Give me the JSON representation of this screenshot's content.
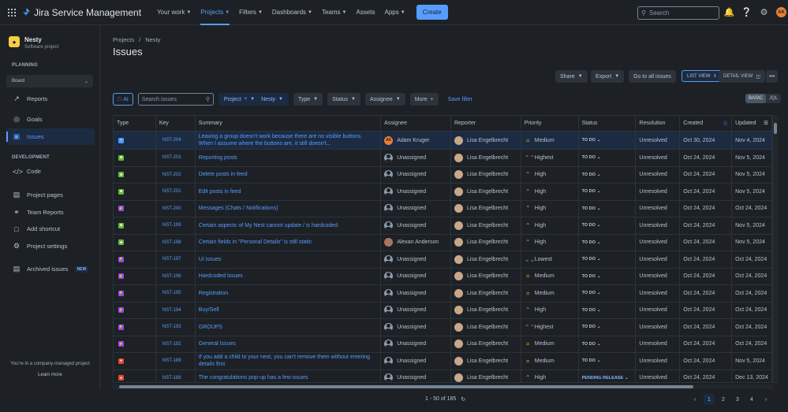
{
  "app": {
    "title": "Jira Service Management"
  },
  "nav": {
    "items": [
      {
        "label": "Your work",
        "active": false
      },
      {
        "label": "Projects",
        "active": true
      },
      {
        "label": "Filters",
        "active": false
      },
      {
        "label": "Dashboards",
        "active": false
      },
      {
        "label": "Teams",
        "active": false
      },
      {
        "label": "Assets",
        "active": false
      },
      {
        "label": "Apps",
        "active": false
      }
    ],
    "create_label": "Create",
    "search_placeholder": "Search",
    "user_initials": "AK"
  },
  "sidebar": {
    "project_name": "Nesty",
    "project_type": "Software project",
    "planning_heading": "PLANNING",
    "board_label": "Board",
    "reports_label": "Reports",
    "goals_label": "Goals",
    "issues_label": "Issues",
    "development_heading": "DEVELOPMENT",
    "code_label": "Code",
    "project_pages_label": "Project pages",
    "team_reports_label": "Team Reports",
    "add_shortcut_label": "Add shortcut",
    "project_settings_label": "Project settings",
    "archived_label": "Archived issues",
    "new_badge": "NEW",
    "footer_text": "You're in a company-managed project",
    "learn_more": "Learn more"
  },
  "page": {
    "breadcrumb": [
      "Projects",
      "Nesty"
    ],
    "title": "Issues",
    "share": "Share",
    "export": "Export",
    "go_all": "Go to all issues",
    "list_view": "LIST VIEW",
    "detail_view": "DETAIL VIEW"
  },
  "filters": {
    "ai": "AI",
    "search_placeholder": "Search issues",
    "project": "Project",
    "project_value": "Nesty",
    "type": "Type",
    "status": "Status",
    "assignee": "Assignee",
    "more": "More",
    "save": "Save filter",
    "basic": "BASIC",
    "jql": "JQL"
  },
  "table": {
    "columns": [
      "Type",
      "Key",
      "Summary",
      "Assignee",
      "Reporter",
      "Priority",
      "Status",
      "Resolution",
      "Created",
      "Updated"
    ],
    "rows": [
      {
        "type": "task",
        "key": "NST-204",
        "summary": "Leaving a group doesn't work because there are no visible buttons. When I assume where the buttons are, it still doesn't...",
        "assignee": "Adam Kruger",
        "assignee_av": "ak",
        "reporter": "Lisa Engelbrecht",
        "priority": "Medium",
        "status": "TO DO",
        "resolution": "Unresolved",
        "created": "Oct 30, 2024",
        "updated": "Nov 4, 2024"
      },
      {
        "type": "story",
        "key": "NST-203",
        "summary": "Reporting posts",
        "assignee": "Unassigned",
        "assignee_av": "un",
        "reporter": "Lisa Engelbrecht",
        "priority": "Highest",
        "status": "TO DO",
        "resolution": "Unresolved",
        "created": "Oct 24, 2024",
        "updated": "Nov 5, 2024"
      },
      {
        "type": "story",
        "key": "NST-202",
        "summary": "Delete posts in feed",
        "assignee": "Unassigned",
        "assignee_av": "un",
        "reporter": "Lisa Engelbrecht",
        "priority": "High",
        "status": "TO DO",
        "resolution": "Unresolved",
        "created": "Oct 24, 2024",
        "updated": "Nov 5, 2024"
      },
      {
        "type": "story",
        "key": "NST-201",
        "summary": "Edit posts in feed",
        "assignee": "Unassigned",
        "assignee_av": "un",
        "reporter": "Lisa Engelbrecht",
        "priority": "High",
        "status": "TO DO",
        "resolution": "Unresolved",
        "created": "Oct 24, 2024",
        "updated": "Nov 5, 2024"
      },
      {
        "type": "epic",
        "key": "NST-200",
        "summary": "Messages (Chats / Notifications)",
        "assignee": "Unassigned",
        "assignee_av": "un",
        "reporter": "Lisa Engelbrecht",
        "priority": "High",
        "status": "TO DO",
        "resolution": "Unresolved",
        "created": "Oct 24, 2024",
        "updated": "Oct 24, 2024"
      },
      {
        "type": "story",
        "key": "NST-199",
        "summary": "Certain aspects of My Nest cannot update / is hardcoded",
        "assignee": "Unassigned",
        "assignee_av": "un",
        "reporter": "Lisa Engelbrecht",
        "priority": "High",
        "status": "TO DO",
        "resolution": "Unresolved",
        "created": "Oct 24, 2024",
        "updated": "Nov 5, 2024"
      },
      {
        "type": "story",
        "key": "NST-198",
        "summary": "Certain fields in \"Personal Details\" is still static",
        "assignee": "Alexan Anderson",
        "assignee_av": "aa",
        "reporter": "Lisa Engelbrecht",
        "priority": "High",
        "status": "TO DO",
        "resolution": "Unresolved",
        "created": "Oct 24, 2024",
        "updated": "Nov 5, 2024"
      },
      {
        "type": "epic",
        "key": "NST-197",
        "summary": "UI issues",
        "assignee": "Unassigned",
        "assignee_av": "un",
        "reporter": "Lisa Engelbrecht",
        "priority": "Lowest",
        "status": "TO DO",
        "resolution": "Unresolved",
        "created": "Oct 24, 2024",
        "updated": "Oct 24, 2024"
      },
      {
        "type": "epic",
        "key": "NST-196",
        "summary": "Hardcoded issues",
        "assignee": "Unassigned",
        "assignee_av": "un",
        "reporter": "Lisa Engelbrecht",
        "priority": "Medium",
        "status": "TO DO",
        "resolution": "Unresolved",
        "created": "Oct 24, 2024",
        "updated": "Oct 24, 2024"
      },
      {
        "type": "epic",
        "key": "NST-195",
        "summary": "Registration",
        "assignee": "Unassigned",
        "assignee_av": "un",
        "reporter": "Lisa Engelbrecht",
        "priority": "Medium",
        "status": "TO DO",
        "resolution": "Unresolved",
        "created": "Oct 24, 2024",
        "updated": "Oct 24, 2024"
      },
      {
        "type": "epic",
        "key": "NST-194",
        "summary": "Buy/Sell",
        "assignee": "Unassigned",
        "assignee_av": "un",
        "reporter": "Lisa Engelbrecht",
        "priority": "High",
        "status": "TO DO",
        "resolution": "Unresolved",
        "created": "Oct 24, 2024",
        "updated": "Oct 24, 2024"
      },
      {
        "type": "epic",
        "key": "NST-193",
        "summary": "GROUPS",
        "assignee": "Unassigned",
        "assignee_av": "un",
        "reporter": "Lisa Engelbrecht",
        "priority": "Highest",
        "status": "TO DO",
        "resolution": "Unresolved",
        "created": "Oct 24, 2024",
        "updated": "Oct 24, 2024"
      },
      {
        "type": "epic",
        "key": "NST-192",
        "summary": "General Issues",
        "assignee": "Unassigned",
        "assignee_av": "un",
        "reporter": "Lisa Engelbrecht",
        "priority": "Medium",
        "status": "TO DO",
        "resolution": "Unresolved",
        "created": "Oct 24, 2024",
        "updated": "Oct 24, 2024"
      },
      {
        "type": "bug",
        "key": "NST-189",
        "summary": "If you add a child to your nest, you can't remove them without entering details first",
        "assignee": "Unassigned",
        "assignee_av": "un",
        "reporter": "Lisa Engelbrecht",
        "priority": "Medium",
        "status": "TO DO",
        "resolution": "Unresolved",
        "created": "Oct 24, 2024",
        "updated": "Nov 5, 2024"
      },
      {
        "type": "bug",
        "key": "NST-188",
        "summary": "The congratulations pop-up has a few issues",
        "assignee": "Unassigned",
        "assignee_av": "un",
        "reporter": "Lisa Engelbrecht",
        "priority": "High",
        "status": "PENDING RELEASE",
        "resolution": "Unresolved",
        "created": "Oct 24, 2024",
        "updated": "Dec 13, 2024"
      }
    ]
  },
  "footer": {
    "count": "1 - 50 of 185",
    "pages": [
      "1",
      "2",
      "3",
      "4"
    ]
  },
  "colors": {
    "accent": "#579dff",
    "task": "#4c9aff",
    "story": "#63ba3c",
    "epic": "#904ee2",
    "bug": "#e5493a",
    "highest": "#f15b50",
    "high": "#f87462",
    "medium": "#e2b203",
    "lowest": "#579dff"
  }
}
